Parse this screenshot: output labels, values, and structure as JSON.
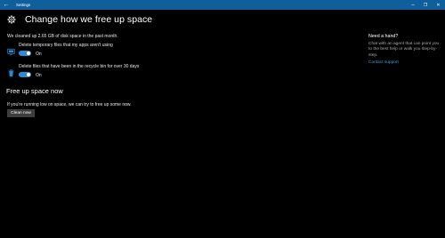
{
  "titlebar": {
    "title": "Settings",
    "back_glyph": "←",
    "minimize_glyph": "–",
    "restore_glyph": "❐",
    "close_glyph": "✕"
  },
  "header": {
    "icon": "gear-icon",
    "title": "Change how we free up space"
  },
  "status": {
    "text": "We cleaned up 2.65 GB of disk space in the past month."
  },
  "options": [
    {
      "icon": "monitor-icon",
      "label": "Delete temporary files that my apps aren't using",
      "toggle_on": true,
      "state_label": "On"
    },
    {
      "icon": "recycle-bin-icon",
      "label": "Delete files that have been in the recycle bin for over 30 days",
      "toggle_on": true,
      "state_label": "On"
    }
  ],
  "free_up": {
    "title": "Free up space now",
    "description": "If you're running low on space, we can try to free up some now.",
    "button_label": "Clean now"
  },
  "help": {
    "title": "Need a hand?",
    "text": "Chat with an agent that can point you to the best help or walk you step-by-step.",
    "link": "Contact support"
  },
  "colors": {
    "titlebar": "#0e5f9b",
    "accent": "#2a8ad4",
    "link": "#3a9ae6",
    "background": "#000000",
    "button": "#3d3d3d"
  }
}
